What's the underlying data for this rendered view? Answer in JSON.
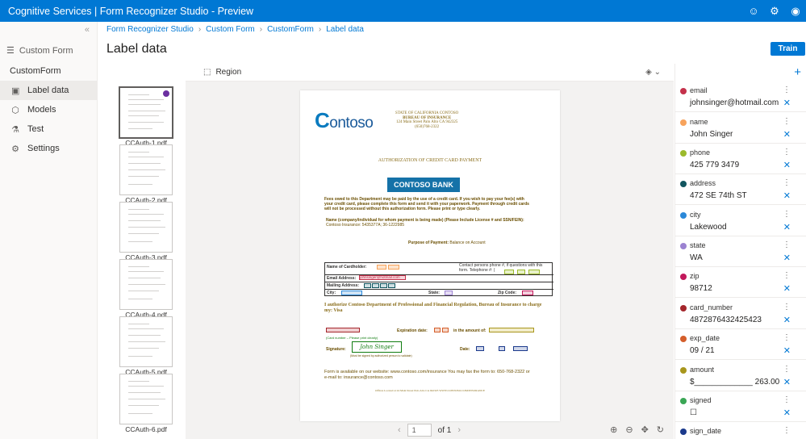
{
  "app": {
    "title": "Cognitive Services | Form Recognizer Studio - Preview",
    "brand_color": "#0078d4"
  },
  "topbar_icons": [
    "smiley-icon",
    "gear-icon",
    "user-icon"
  ],
  "nav": {
    "project_type": "Custom Form",
    "project_name": "CustomForm",
    "items": [
      {
        "label": "Label data",
        "icon": "label-icon",
        "active": true
      },
      {
        "label": "Models",
        "icon": "cube-icon",
        "active": false
      },
      {
        "label": "Test",
        "icon": "flask-icon",
        "active": false
      },
      {
        "label": "Settings",
        "icon": "gear-icon",
        "active": false
      }
    ]
  },
  "breadcrumb": [
    "Form Recognizer Studio",
    "Custom Form",
    "CustomForm",
    "Label data"
  ],
  "page_title": "Label data",
  "train_label": "Train",
  "thumbnails": [
    {
      "name": "CCAuth-1.pdf",
      "selected": true
    },
    {
      "name": "CCAuth-2.pdf",
      "selected": false
    },
    {
      "name": "CCAuth-3.pdf",
      "selected": false
    },
    {
      "name": "CCAuth-4.pdf",
      "selected": false
    },
    {
      "name": "CCAuth-5.pdf",
      "selected": false
    },
    {
      "name": "CCAuth-6.pdf",
      "selected": false
    }
  ],
  "toolbar": {
    "region_label": "Region"
  },
  "document": {
    "logo": "ontoso",
    "header_lines": [
      "STATE OF CALIFORNIA CONTOSO",
      "BUREAU OF INSURANCE",
      "124 Main Street Palo Alto CA 942325",
      "(650)768-2322"
    ],
    "auth_title": "AUTHORIZATION OF CREDIT CARD PAYMENT",
    "bank": "CONTOSO BANK",
    "fees_text": "Fees owed to this Department may be paid by the use of a credit card. If you wish to pay your fee(s) with your credit card, please complete this form and send it with your paperwork. Payment through credit cards will not be processed without this authorization form. Please print or type clearly.",
    "name_label": "Name (company/individual for whom payment is being made) (Please Include License # and SSN/FEIN):",
    "name_value": "Contoso Insurance: 5435377A; 36-1222985",
    "purpose_label": "Purpose of Payment:",
    "purpose_value": "Balance on Account",
    "table": {
      "cardholder": "Name of Cardholder:",
      "contact": "Contact persons phone #, if questions with this form. Telephone #: (",
      "email": "Email Address:",
      "email_value": "johnsinger@hotmail.com",
      "mailing": "Mailing Address:",
      "city": "City:",
      "state": "State:",
      "zip": "Zip Code:"
    },
    "authorize": "I authorize Contoso Department of Professional and Financial Regulation, Bureau of Insurance to charge my: Visa",
    "expiration": "Expiration date:",
    "amount": "in the amount of:",
    "card_number_caption": "(Card number – Please print clearly)",
    "signature_label": "Signature:",
    "signature_value": "John Singer",
    "date_label": "Date:",
    "signed_caption": "(Must be signed by authorized person to validate)",
    "footer": "Form is available on our website: www.contoso.com/insurance You may fax the form to: 650-768-2322 or e-mail to: insurance@contoso.com",
    "small_footer": "Offices Located at 24 Main Street Palo Alto CA 942325 WWW.CONTOSO.COM/INSURANCE"
  },
  "pager": {
    "page": "1",
    "of": "of 1"
  },
  "fields": [
    {
      "name": "email",
      "value": "johnsinger@hotmail.com",
      "color": "#c4314b"
    },
    {
      "name": "name",
      "value": "John Singer",
      "color": "#f7a35c"
    },
    {
      "name": "phone",
      "value": "425 779 3479",
      "color": "#9bba2c"
    },
    {
      "name": "address",
      "value": "472 SE 74th ST",
      "color": "#11555f"
    },
    {
      "name": "city",
      "value": "Lakewood",
      "color": "#2b88d8"
    },
    {
      "name": "state",
      "value": "WA",
      "color": "#9b82d1"
    },
    {
      "name": "zip",
      "value": "98712",
      "color": "#c2185b"
    },
    {
      "name": "card_number",
      "value": "4872876432425423",
      "color": "#a4262c"
    },
    {
      "name": "exp_date",
      "value": "09 / 21",
      "color": "#d45e2b"
    },
    {
      "name": "amount",
      "value": "$_____________ 263.00",
      "color": "#a8961c"
    },
    {
      "name": "signed",
      "value": "☐",
      "color": "#3aa655"
    },
    {
      "name": "sign_date",
      "value": "",
      "color": "#1b3a8c"
    }
  ]
}
